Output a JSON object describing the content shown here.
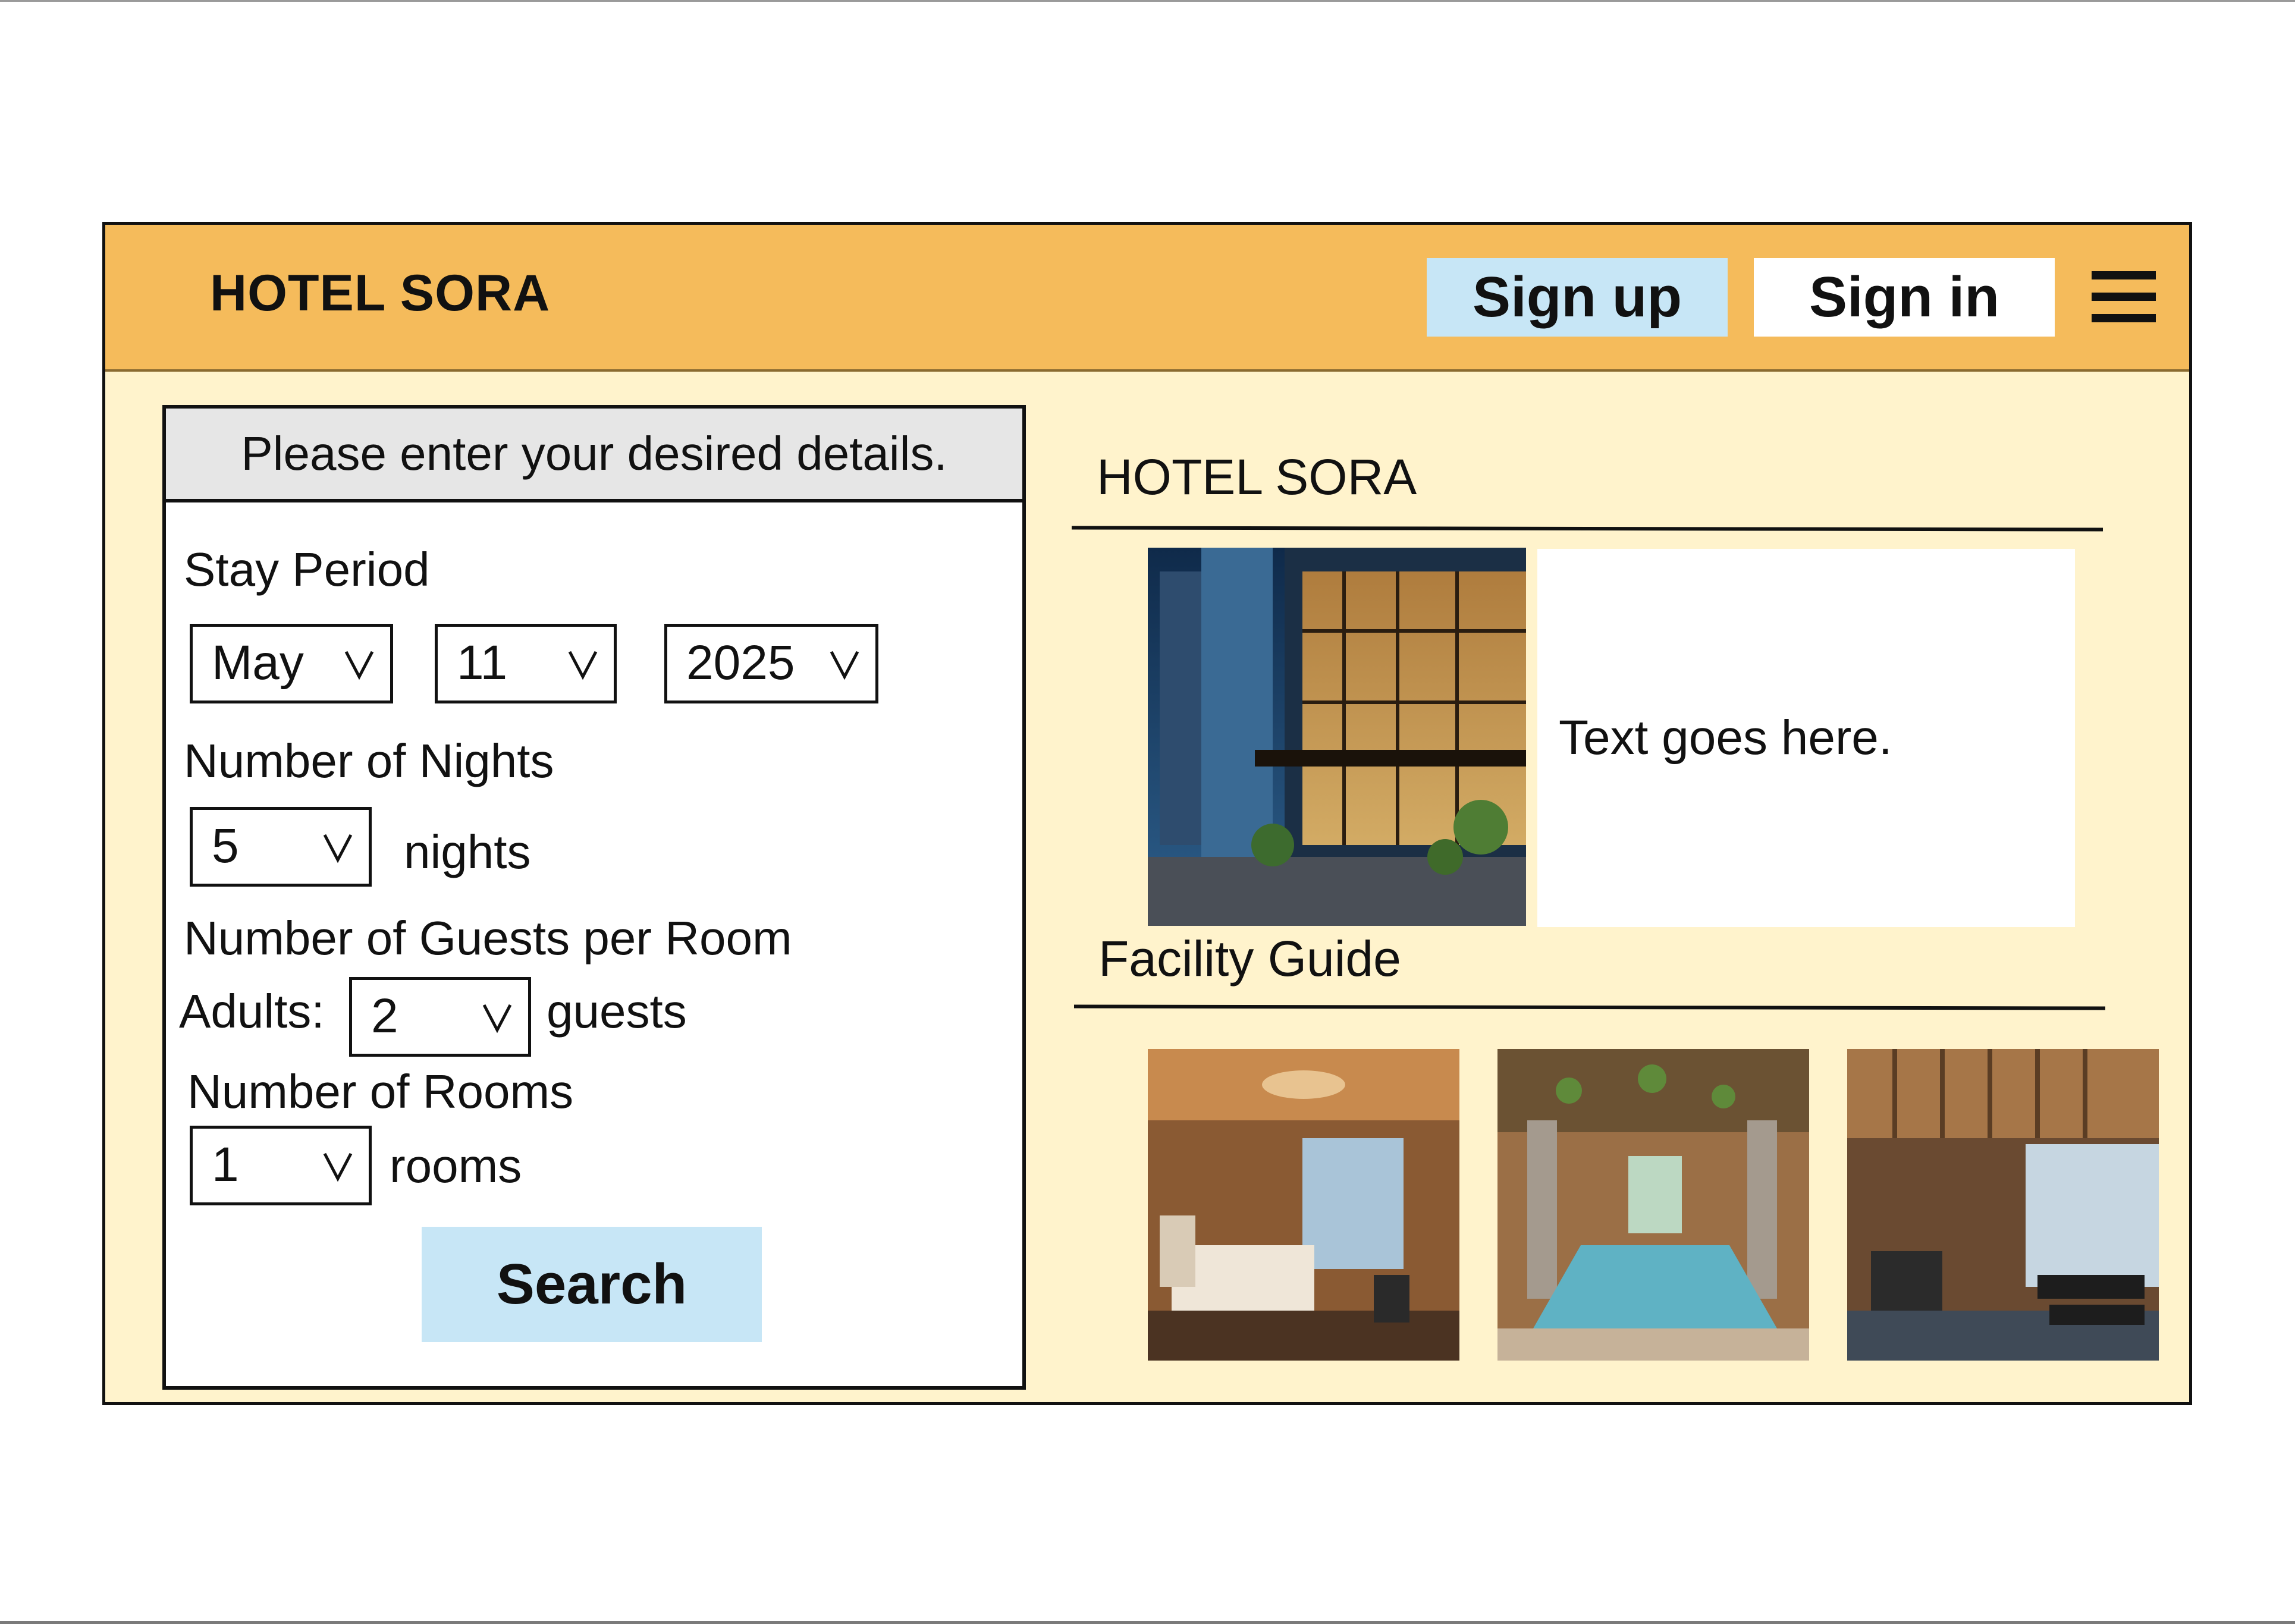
{
  "header": {
    "brand": "HOTEL SORA",
    "signup_label": "Sign up",
    "signin_label": "Sign in",
    "menu_icon": "hamburger-menu-icon"
  },
  "form": {
    "title": "Please enter your desired details.",
    "stay_period": {
      "label": "Stay Period",
      "month": "May",
      "day": "11",
      "year": "2025"
    },
    "nights": {
      "label": "Number of Nights",
      "value": "5",
      "unit": "nights"
    },
    "guests": {
      "label": "Number of Guests per Room",
      "adults_label": "Adults:",
      "value": "2",
      "unit": "guests"
    },
    "rooms": {
      "label": "Number of Rooms",
      "value": "1",
      "unit": "rooms"
    },
    "dropdown_icon": "chevron-down-icon",
    "search_label": "Search"
  },
  "intro": {
    "title": "HOTEL SORA",
    "text": "Text goes here."
  },
  "facility": {
    "title": "Facility Guide"
  },
  "colors": {
    "header_bg": "#f5bb5b",
    "content_bg": "#fff3cc",
    "button_blue": "#c7e6f6",
    "form_header_bg": "#e6e6e6"
  }
}
